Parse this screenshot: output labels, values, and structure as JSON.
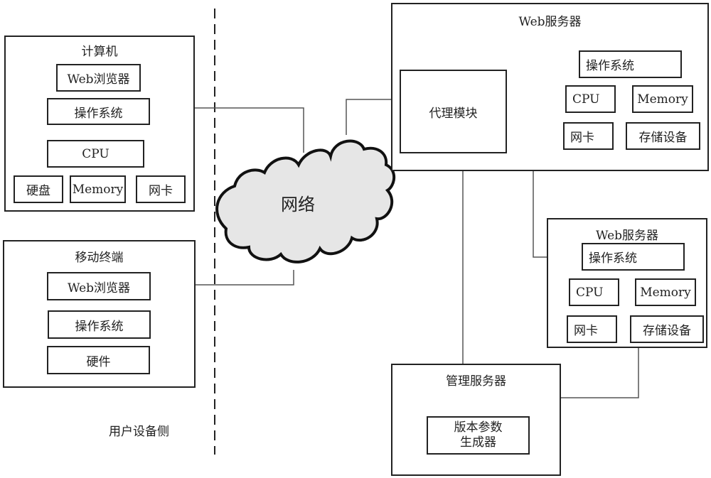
{
  "network": {
    "label": "网络"
  },
  "user_side_label": "用户设备侧",
  "computer": {
    "title": "计算机",
    "browser": "Web浏览器",
    "os": "操作系统",
    "cpu": "CPU",
    "disk": "硬盘",
    "memory": "Memory",
    "nic": "网卡"
  },
  "mobile": {
    "title": "移动终端",
    "browser": "Web浏览器",
    "os": "操作系统",
    "hardware": "硬件"
  },
  "web_server_1": {
    "title": "Web服务器",
    "proxy": "代理模块",
    "os": "操作系统",
    "cpu": "CPU",
    "memory": "Memory",
    "nic": "网卡",
    "storage": "存储设备"
  },
  "web_server_2": {
    "title": "Web服务器",
    "os": "操作系统",
    "cpu": "CPU",
    "memory": "Memory",
    "nic": "网卡",
    "storage": "存储设备"
  },
  "management_server": {
    "title": "管理服务器",
    "generator_line1": "版本参数",
    "generator_line2": "生成器"
  }
}
